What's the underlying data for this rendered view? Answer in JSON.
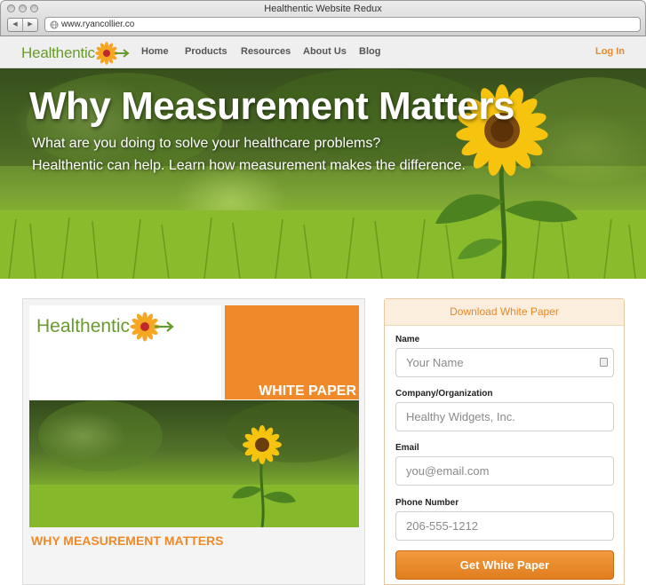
{
  "window": {
    "title": "Healthentic Website Redux"
  },
  "browser": {
    "url": "www.ryancollier.co",
    "back_glyph": "◀",
    "forward_glyph": "▶"
  },
  "site": {
    "logo_text": "Healthentic",
    "nav": [
      "Home",
      "Products",
      "Resources",
      "About Us",
      "Blog"
    ],
    "login_label": "Log In",
    "accent_color": "#e8892a",
    "brand_green": "#6a9a2e"
  },
  "hero": {
    "title": "Why Measurement Matters",
    "subtitle_line1": "What are you doing to solve your healthcare problems?",
    "subtitle_line2": "Healthentic can help. Learn how measurement makes the difference."
  },
  "white_paper": {
    "logo_text": "Healthentic",
    "label": "WHITE PAPER",
    "caption": "WHY MEASUREMENT MATTERS"
  },
  "form": {
    "header": "Download White Paper",
    "name_label": "Name",
    "name_placeholder": "Your Name",
    "company_label": "Company/Organization",
    "company_placeholder": "Healthy Widgets, Inc.",
    "email_label": "Email",
    "email_placeholder": "you@email.com",
    "phone_label": "Phone Number",
    "phone_placeholder": "206-555-1212",
    "submit_label": "Get White Paper"
  }
}
